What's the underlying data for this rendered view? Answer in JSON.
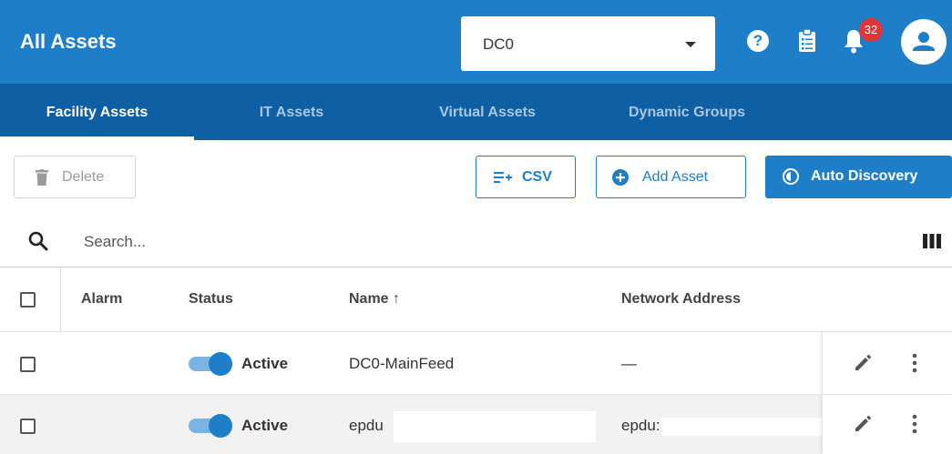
{
  "header": {
    "title": "All Assets",
    "datacenter_selected": "DC0",
    "notification_count": "32",
    "icons": [
      "help-icon",
      "clipboard-icon",
      "bell-icon",
      "user-icon"
    ]
  },
  "tabs": [
    {
      "label": "Facility Assets",
      "active": true
    },
    {
      "label": "IT Assets",
      "active": false
    },
    {
      "label": "Virtual Assets",
      "active": false
    },
    {
      "label": "Dynamic Groups",
      "active": false
    }
  ],
  "toolbar": {
    "delete_label": "Delete",
    "csv_label": "CSV",
    "add_label": "Add Asset",
    "auto_label": "Auto Discovery"
  },
  "search": {
    "placeholder": "Search..."
  },
  "table": {
    "columns": [
      "Alarm",
      "Status",
      "Name ↑",
      "Network Address"
    ],
    "rows": [
      {
        "alarm": "",
        "status": "Active",
        "name": "DC0-MainFeed",
        "network_address": "—"
      },
      {
        "alarm": "",
        "status": "Active",
        "name": "epdu",
        "network_address": "epdu:"
      }
    ]
  },
  "colors": {
    "header_bg": "#1e7ec7",
    "tabbar_bg": "#0e5fa3",
    "accent": "#1e7ec7",
    "badge": "#e0353b",
    "row_selected_bg": "#f2f2f2"
  }
}
